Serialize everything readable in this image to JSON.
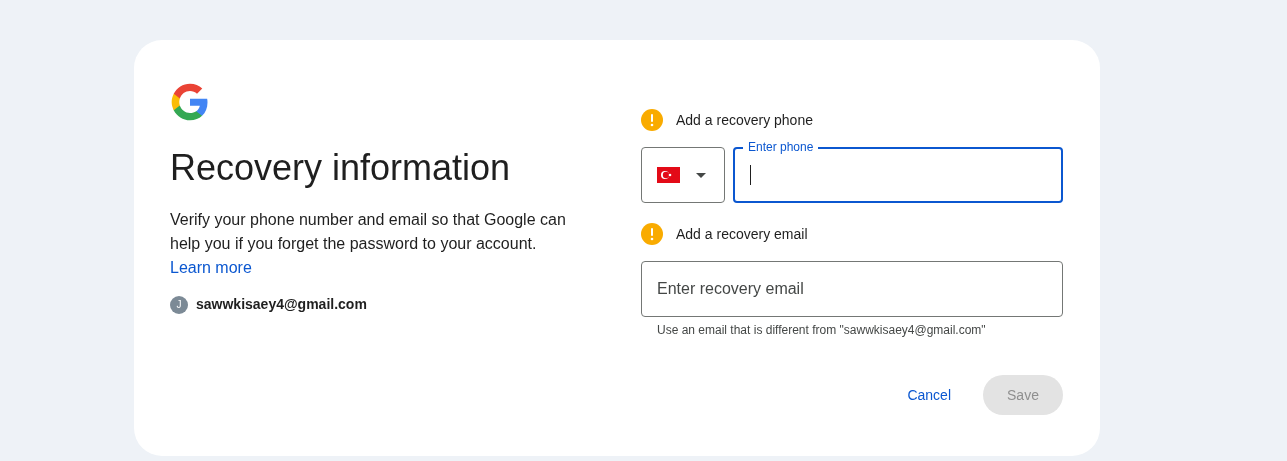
{
  "title": "Recovery information",
  "description": "Verify your phone number and email so that Google can help you if you forget the password to your account.",
  "learn_more": "Learn more",
  "account": {
    "initial": "J",
    "email": "sawwkisaey4@gmail.com"
  },
  "phone": {
    "heading": "Add a recovery phone",
    "label": "Enter phone",
    "focused": true
  },
  "email": {
    "heading": "Add a recovery email",
    "placeholder": "Enter recovery email",
    "hint": "Use an email that is different from \"sawwkisaey4@gmail.com\""
  },
  "buttons": [
    {
      "kind": "link",
      "label": "Cancel",
      "disabled": false
    },
    {
      "kind": "filled",
      "label": "Save",
      "disabled": true
    }
  ]
}
